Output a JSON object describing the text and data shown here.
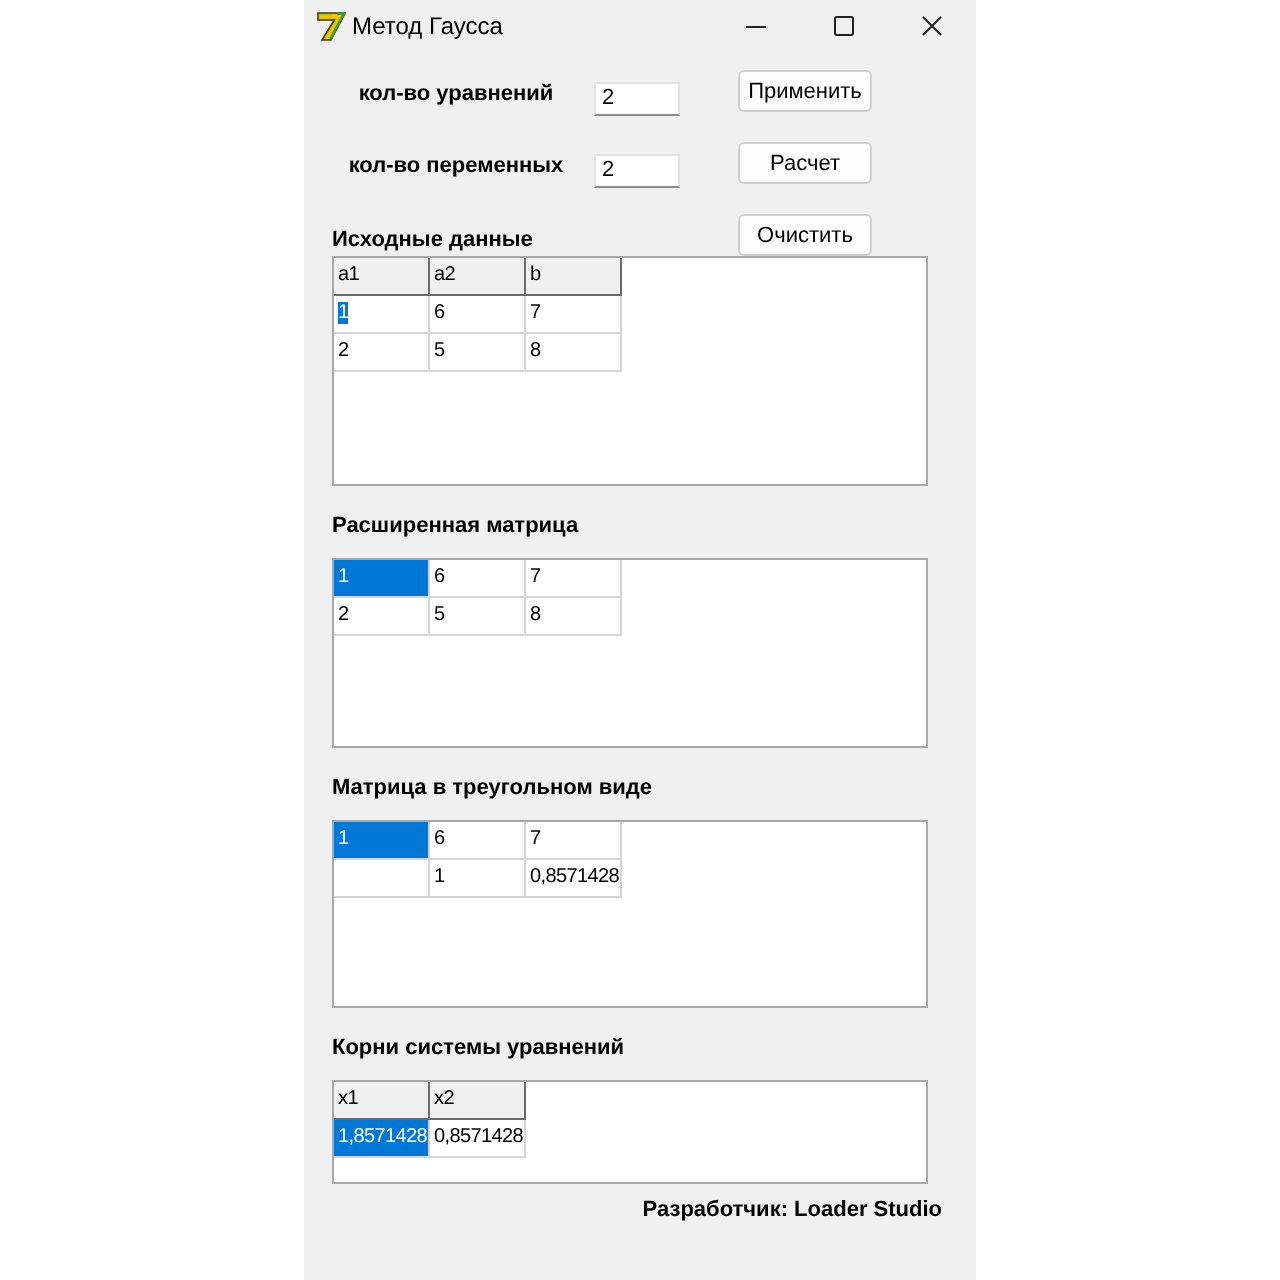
{
  "window": {
    "title": "Метод Гаусса"
  },
  "fields": [
    {
      "label": "кол-во уравнений",
      "value": "2"
    },
    {
      "label": "кол-во переменных",
      "value": "2"
    }
  ],
  "buttons": [
    "Применить",
    "Расчет",
    "Очистить"
  ],
  "grids": [
    {
      "title": "Исходные данные",
      "header": [
        "a1",
        "a2",
        "b"
      ],
      "rows": [
        {
          "cells": [
            {
              "text": "1",
              "selected": true,
              "editing": true
            },
            {
              "text": "6",
              "selected": false,
              "editing": false
            },
            {
              "text": "7",
              "selected": false,
              "editing": false
            }
          ]
        },
        {
          "cells": [
            {
              "text": "2",
              "selected": false,
              "editing": false
            },
            {
              "text": "5",
              "selected": false,
              "editing": false
            },
            {
              "text": "8",
              "selected": false,
              "editing": false
            }
          ]
        }
      ]
    },
    {
      "title": "Расширенная матрица",
      "rows": [
        {
          "cells": [
            {
              "text": "1",
              "selected": true,
              "editing": false
            },
            {
              "text": "6",
              "selected": false,
              "editing": false
            },
            {
              "text": "7",
              "selected": false,
              "editing": false
            }
          ]
        },
        {
          "cells": [
            {
              "text": "2",
              "selected": false,
              "editing": false
            },
            {
              "text": "5",
              "selected": false,
              "editing": false
            },
            {
              "text": "8",
              "selected": false,
              "editing": false
            }
          ]
        }
      ]
    },
    {
      "title": "Матрица в треугольном виде",
      "rows": [
        {
          "cells": [
            {
              "text": "1",
              "selected": true,
              "editing": false
            },
            {
              "text": "6",
              "selected": false,
              "editing": false
            },
            {
              "text": "7",
              "selected": false,
              "editing": false
            }
          ]
        },
        {
          "cells": [
            {
              "selected": false,
              "editing": false
            },
            {
              "text": "1",
              "selected": false,
              "editing": false
            },
            {
              "text": "0,8571428",
              "selected": false,
              "editing": false
            }
          ]
        }
      ]
    },
    {
      "title": "Корни системы уравнений",
      "header": [
        "x1",
        "x2"
      ],
      "rows": [
        {
          "cells": [
            {
              "text": "1,8571428",
              "selected": true,
              "editing": false
            },
            {
              "text": "0,8571428",
              "selected": false,
              "editing": false
            }
          ]
        }
      ]
    }
  ],
  "footer": "Разработчик: Loader Studio"
}
